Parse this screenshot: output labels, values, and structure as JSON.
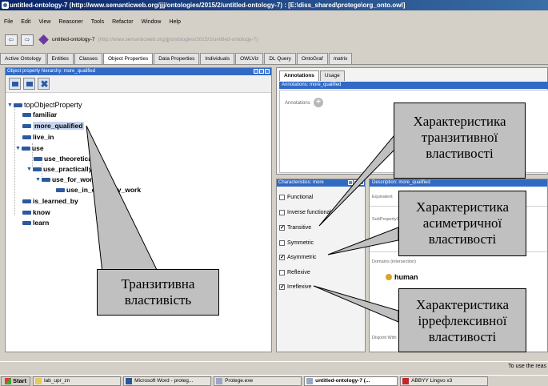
{
  "window": {
    "title": "untitled-ontology-7 (http://www.semanticweb.org/jjj/ontologies/2015/2/untitled-ontology-7) : [E:\\diss_shared\\protege\\org_onto.owl]"
  },
  "menu": [
    "File",
    "Edit",
    "View",
    "Reasoner",
    "Tools",
    "Refactor",
    "Window",
    "Help"
  ],
  "addressbar": {
    "name": "untitled-ontology-7",
    "iri": "(http://www.semanticweb.org/jjj/ontologies/2015/2/untitled-ontology-7)"
  },
  "tabs": [
    "Active Ontology",
    "Entities",
    "Classes",
    "Object Properties",
    "Data Properties",
    "Individuals",
    "OWLViz",
    "DL Query",
    "OntoGraf",
    "matrix"
  ],
  "hierarchy": {
    "header": "Object property hierarchy: more_qualified",
    "nodes": {
      "root": "topObjectProperty",
      "familiar": "familiar",
      "more_qualified": "more_qualified",
      "live_in": "live_in",
      "use": "use",
      "use_theoretically": "use_theoretically",
      "use_practically": "use_practically",
      "use_for_work": "use_for_work",
      "use_in_everyday_work": "use_in_everyday_work",
      "is_learned_by": "is_learned_by",
      "know": "know",
      "learn": "learn"
    }
  },
  "annotations": {
    "tabs": [
      "Annotations",
      "Usage"
    ],
    "header": "Annotations: more_qualified",
    "label": "Annotations"
  },
  "characteristics": {
    "header": "Characteristics: more",
    "items": [
      {
        "label": "Functional",
        "checked": false
      },
      {
        "label": "Inverse functional",
        "checked": false
      },
      {
        "label": "Transitive",
        "checked": true
      },
      {
        "label": "Symmetric",
        "checked": false
      },
      {
        "label": "Asymmetric",
        "checked": true
      },
      {
        "label": "Reflexive",
        "checked": false
      },
      {
        "label": "Irreflexive",
        "checked": true
      }
    ]
  },
  "description": {
    "header": "Description: more_qualified",
    "sections": {
      "equivalent": "Equivalent",
      "subproperty": "SubPropertyOf",
      "domains": "Domains (intersection)",
      "disjoint": "Disjoint With"
    },
    "domain_value": "human",
    "range_value_fragment": "h"
  },
  "status": "To use the reas",
  "taskbar": {
    "start": "Start",
    "items": [
      "lab_upr_zn",
      "Microsoft Word - proteg...",
      "Protege.exe",
      "untitled-ontology-7 (...",
      "ABBYY Lingvo x3"
    ]
  },
  "callouts": {
    "transitive_char": [
      "Характеристика",
      "транзитивної",
      "властивості"
    ],
    "asymmetric_char": [
      "Характеристика",
      "асиметричної",
      "властивості"
    ],
    "irreflexive_char": [
      "Характеристика",
      "іррефлексивної",
      "властивості"
    ],
    "transitive_prop": [
      "Транзитивна",
      "властивість"
    ]
  },
  "colors": {
    "selection": "#316ac5",
    "property_bar": "#2c5aa0",
    "class_dot": "#d9a428",
    "callout_fill": "#c0c0c0"
  }
}
